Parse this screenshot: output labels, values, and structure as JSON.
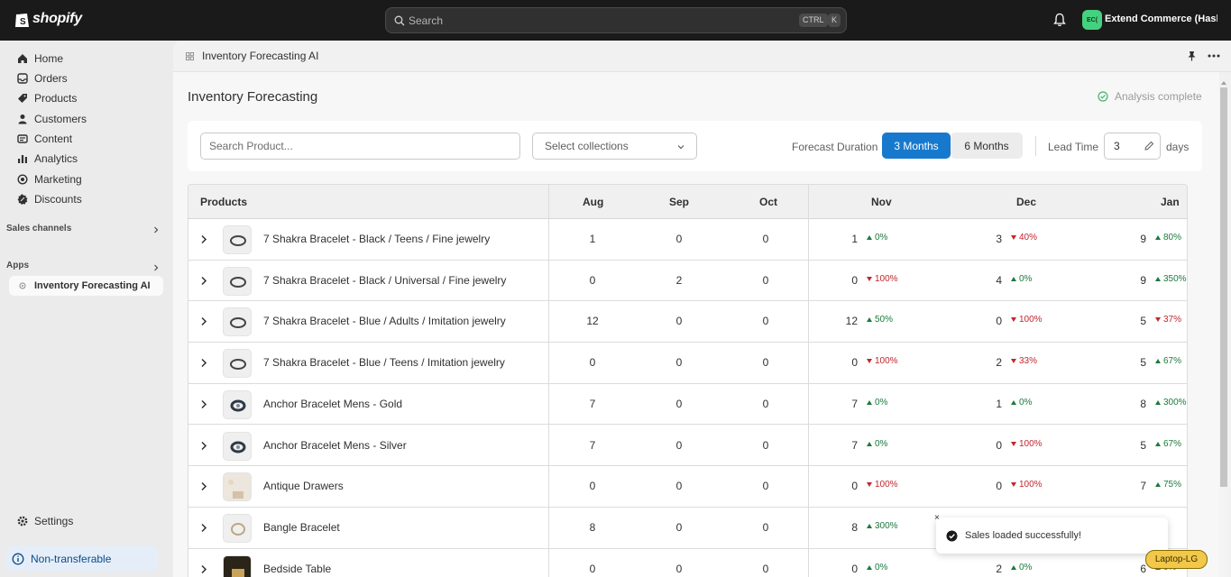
{
  "brand": {
    "name": "shopify"
  },
  "search": {
    "placeholder": "Search",
    "shortcut_ctrl": "CTRL",
    "shortcut_key": "K"
  },
  "account": {
    "initials": "EC(",
    "store_name": "Extend Commerce (Hash..."
  },
  "sidebar": {
    "items": [
      {
        "label": "Home",
        "icon": "home-icon"
      },
      {
        "label": "Orders",
        "icon": "orders-icon"
      },
      {
        "label": "Products",
        "icon": "tag-icon"
      },
      {
        "label": "Customers",
        "icon": "person-icon"
      },
      {
        "label": "Content",
        "icon": "content-icon"
      },
      {
        "label": "Analytics",
        "icon": "bar-chart-icon"
      },
      {
        "label": "Marketing",
        "icon": "target-icon"
      },
      {
        "label": "Discounts",
        "icon": "discount-icon"
      }
    ],
    "sales_channels_label": "Sales channels",
    "apps_label": "Apps",
    "app_item": "Inventory Forecasting AI",
    "settings_label": "Settings",
    "nontransferable_label": "Non-transferable"
  },
  "appbar": {
    "title": "Inventory Forecasting AI"
  },
  "page": {
    "title": "Inventory Forecasting",
    "status": "Analysis complete"
  },
  "toolbar": {
    "search_placeholder": "Search Product...",
    "collections_placeholder": "Select collections",
    "forecast_label": "Forecast Duration",
    "option_3": "3 Months",
    "option_6": "6 Months",
    "selected": "3 Months",
    "lead_label": "Lead Time",
    "lead_value": "3",
    "days_label": "days"
  },
  "table": {
    "headers": [
      "Products",
      "Aug",
      "Sep",
      "Oct",
      "Nov",
      "Dec",
      "Jan"
    ],
    "rows": [
      {
        "name": "7 Shakra Bracelet - Black / Teens / Fine jewelry",
        "aug": "1",
        "sep": "0",
        "oct": "0",
        "nov": "1",
        "nov_pct": "0%",
        "nov_dir": "up",
        "dec": "3",
        "dec_pct": "40%",
        "dec_dir": "down",
        "jan": "9",
        "jan_pct": "80%",
        "jan_dir": "up",
        "thumb": "bracelet-icon"
      },
      {
        "name": "7 Shakra Bracelet - Black / Universal / Fine jewelry",
        "aug": "0",
        "sep": "2",
        "oct": "0",
        "nov": "0",
        "nov_pct": "100%",
        "nov_dir": "down",
        "dec": "4",
        "dec_pct": "0%",
        "dec_dir": "up",
        "jan": "9",
        "jan_pct": "350%",
        "jan_dir": "up",
        "thumb": "bracelet-icon"
      },
      {
        "name": "7 Shakra Bracelet - Blue / Adults / Imitation jewelry",
        "aug": "12",
        "sep": "0",
        "oct": "0",
        "nov": "12",
        "nov_pct": "50%",
        "nov_dir": "up",
        "dec": "0",
        "dec_pct": "100%",
        "dec_dir": "down",
        "jan": "5",
        "jan_pct": "37%",
        "jan_dir": "down",
        "thumb": "bracelet-icon"
      },
      {
        "name": "7 Shakra Bracelet - Blue / Teens / Imitation jewelry",
        "aug": "0",
        "sep": "0",
        "oct": "0",
        "nov": "0",
        "nov_pct": "100%",
        "nov_dir": "down",
        "dec": "2",
        "dec_pct": "33%",
        "dec_dir": "down",
        "jan": "5",
        "jan_pct": "67%",
        "jan_dir": "up",
        "thumb": "bracelet-icon"
      },
      {
        "name": "Anchor Bracelet Mens - Gold",
        "aug": "7",
        "sep": "0",
        "oct": "0",
        "nov": "7",
        "nov_pct": "0%",
        "nov_dir": "up",
        "dec": "1",
        "dec_pct": "0%",
        "dec_dir": "up",
        "jan": "8",
        "jan_pct": "300%",
        "jan_dir": "up",
        "thumb": "anchor-bracelet-icon"
      },
      {
        "name": "Anchor Bracelet Mens - Silver",
        "aug": "7",
        "sep": "0",
        "oct": "0",
        "nov": "7",
        "nov_pct": "0%",
        "nov_dir": "up",
        "dec": "0",
        "dec_pct": "100%",
        "dec_dir": "down",
        "jan": "5",
        "jan_pct": "67%",
        "jan_dir": "up",
        "thumb": "anchor-bracelet-icon"
      },
      {
        "name": "Antique Drawers",
        "aug": "0",
        "sep": "0",
        "oct": "0",
        "nov": "0",
        "nov_pct": "100%",
        "nov_dir": "down",
        "dec": "0",
        "dec_pct": "100%",
        "dec_dir": "down",
        "jan": "7",
        "jan_pct": "75%",
        "jan_dir": "up",
        "thumb": "drawers-icon"
      },
      {
        "name": "Bangle Bracelet",
        "aug": "8",
        "sep": "0",
        "oct": "0",
        "nov": "8",
        "nov_pct": "300%",
        "nov_dir": "up",
        "dec": "",
        "dec_pct": "",
        "dec_dir": "up",
        "jan": "",
        "jan_pct": "",
        "jan_dir": "up",
        "thumb": "bangle-icon"
      },
      {
        "name": "Bedside Table",
        "aug": "0",
        "sep": "0",
        "oct": "0",
        "nov": "0",
        "nov_pct": "0%",
        "nov_dir": "up",
        "dec": "2",
        "dec_pct": "0%",
        "dec_dir": "up",
        "jan": "6",
        "jan_pct": "0%",
        "jan_dir": "up",
        "thumb": "table-icon"
      }
    ]
  },
  "toast": {
    "message": "Sales loaded successfully!",
    "close": "×"
  },
  "badge": {
    "label": "Laptop-LG"
  },
  "colors": {
    "primary": "#1779ce",
    "topbar": "#1a1a1a",
    "up": "#1b7a3c",
    "down": "#c0272d",
    "avatar": "#45d17e"
  }
}
